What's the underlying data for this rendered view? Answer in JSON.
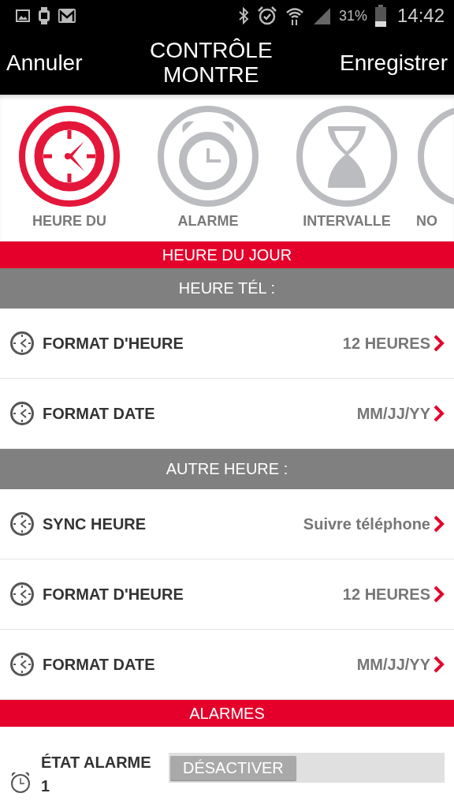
{
  "status_bar": {
    "battery_text": "31%",
    "time": "14:42"
  },
  "header": {
    "cancel": "Annuler",
    "title": "CONTRÔLE MONTRE",
    "save": "Enregistrer"
  },
  "tabs": [
    {
      "kind": "clock",
      "label": "HEURE DU",
      "selected": true
    },
    {
      "kind": "alarm",
      "label": "ALARME",
      "selected": false
    },
    {
      "kind": "hourglass",
      "label": "INTERVALLE",
      "selected": false
    },
    {
      "kind": "other",
      "label": "NO",
      "selected": false
    }
  ],
  "sections": [
    {
      "kind": "red",
      "title": "HEURE DU JOUR"
    },
    {
      "kind": "gray",
      "title": "HEURE TÉL :",
      "rows": [
        {
          "label": "FORMAT D'HEURE",
          "value": "12 HEURES"
        },
        {
          "label": "FORMAT DATE",
          "value": "MM/JJ/YY"
        }
      ]
    },
    {
      "kind": "gray",
      "title": "AUTRE HEURE :",
      "rows": [
        {
          "label": "SYNC HEURE",
          "value": "Suivre téléphone"
        },
        {
          "label": "FORMAT D'HEURE",
          "value": "12 HEURES"
        },
        {
          "label": "FORMAT DATE",
          "value": "MM/JJ/YY"
        }
      ]
    },
    {
      "kind": "red",
      "title": "ALARMES"
    }
  ],
  "alarm_row": {
    "label": "ÉTAT ALARME 1",
    "toggle_text": "DÉSACTIVER",
    "on": false
  }
}
